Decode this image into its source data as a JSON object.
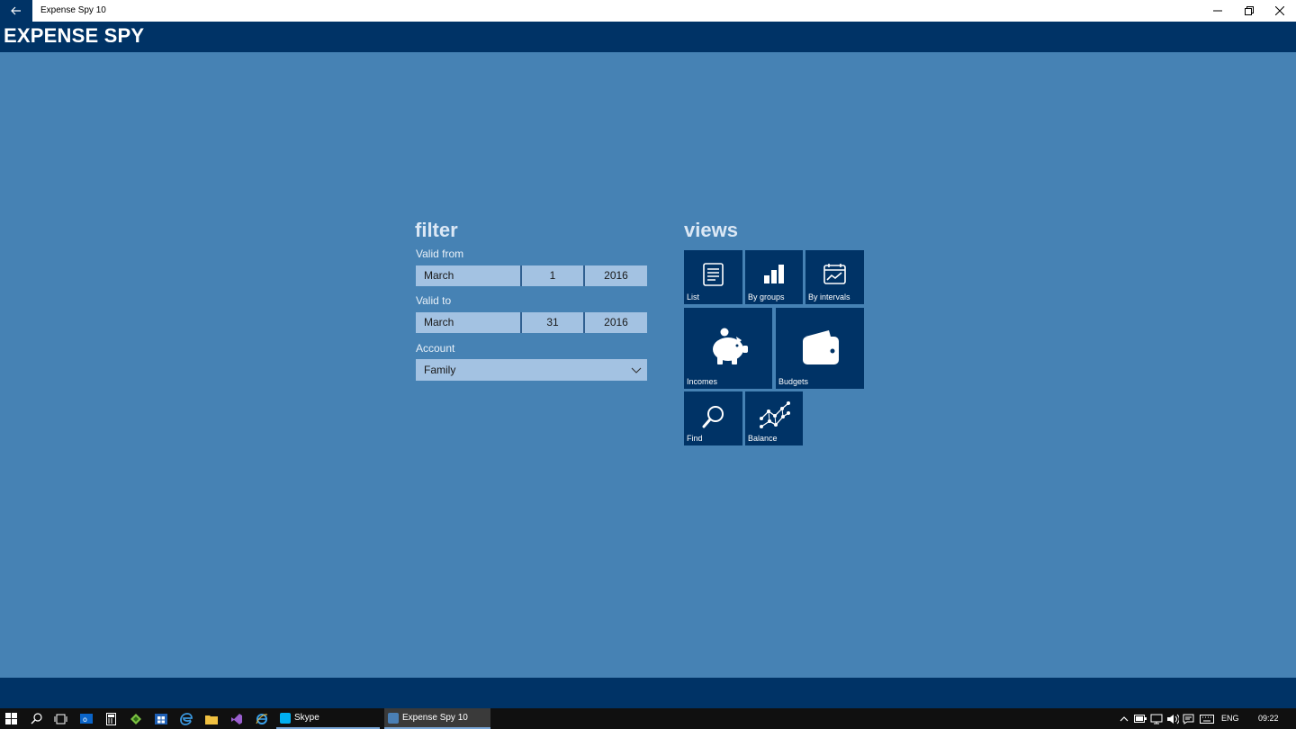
{
  "window": {
    "title": "Expense Spy 10"
  },
  "app": {
    "title": "EXPENSE SPY"
  },
  "filter": {
    "title": "filter",
    "valid_from": {
      "label": "Valid from",
      "month": "March",
      "day": "1",
      "year": "2016"
    },
    "valid_to": {
      "label": "Valid to",
      "month": "March",
      "day": "31",
      "year": "2016"
    },
    "account": {
      "label": "Account",
      "value": "Family"
    }
  },
  "views": {
    "title": "views",
    "tiles": [
      {
        "label": "List",
        "icon": "list-icon"
      },
      {
        "label": "By groups",
        "icon": "bar-chart-icon"
      },
      {
        "label": "By intervals",
        "icon": "calendar-chart-icon"
      },
      {
        "label": "Incomes",
        "icon": "piggy-bank-icon"
      },
      {
        "label": "Budgets",
        "icon": "wallet-icon"
      },
      {
        "label": "Find",
        "icon": "search-icon"
      },
      {
        "label": "Balance",
        "icon": "network-icon"
      }
    ]
  },
  "taskbar": {
    "tasks": [
      {
        "label": "Skype"
      },
      {
        "label": "Expense Spy 10"
      }
    ],
    "language": "ENG",
    "time": "09:22"
  },
  "colors": {
    "background": "#4682b4",
    "header": "#003366",
    "field": "#a3c2e2",
    "taskbar": "#101010"
  }
}
